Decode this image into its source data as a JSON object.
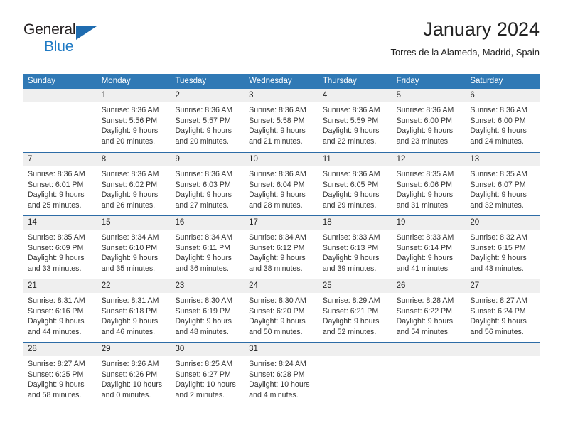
{
  "brand": {
    "name_top": "General",
    "name_bottom": "Blue",
    "triangle_color": "#1f6cb0",
    "blue_text_color": "#1f7ac4"
  },
  "header": {
    "title": "January 2024",
    "subtitle": "Torres de la Alameda, Madrid, Spain"
  },
  "theme": {
    "header_bg": "#3079b5",
    "header_text": "#ffffff",
    "daynum_bg": "#efefef",
    "row_border": "#2d6ca6",
    "body_text": "#333333"
  },
  "weekdays": [
    "Sunday",
    "Monday",
    "Tuesday",
    "Wednesday",
    "Thursday",
    "Friday",
    "Saturday"
  ],
  "weeks": [
    [
      {
        "day": "",
        "sunrise": "",
        "sunset": "",
        "daylight1": "",
        "daylight2": ""
      },
      {
        "day": "1",
        "sunrise": "Sunrise: 8:36 AM",
        "sunset": "Sunset: 5:56 PM",
        "daylight1": "Daylight: 9 hours",
        "daylight2": "and 20 minutes."
      },
      {
        "day": "2",
        "sunrise": "Sunrise: 8:36 AM",
        "sunset": "Sunset: 5:57 PM",
        "daylight1": "Daylight: 9 hours",
        "daylight2": "and 20 minutes."
      },
      {
        "day": "3",
        "sunrise": "Sunrise: 8:36 AM",
        "sunset": "Sunset: 5:58 PM",
        "daylight1": "Daylight: 9 hours",
        "daylight2": "and 21 minutes."
      },
      {
        "day": "4",
        "sunrise": "Sunrise: 8:36 AM",
        "sunset": "Sunset: 5:59 PM",
        "daylight1": "Daylight: 9 hours",
        "daylight2": "and 22 minutes."
      },
      {
        "day": "5",
        "sunrise": "Sunrise: 8:36 AM",
        "sunset": "Sunset: 6:00 PM",
        "daylight1": "Daylight: 9 hours",
        "daylight2": "and 23 minutes."
      },
      {
        "day": "6",
        "sunrise": "Sunrise: 8:36 AM",
        "sunset": "Sunset: 6:00 PM",
        "daylight1": "Daylight: 9 hours",
        "daylight2": "and 24 minutes."
      }
    ],
    [
      {
        "day": "7",
        "sunrise": "Sunrise: 8:36 AM",
        "sunset": "Sunset: 6:01 PM",
        "daylight1": "Daylight: 9 hours",
        "daylight2": "and 25 minutes."
      },
      {
        "day": "8",
        "sunrise": "Sunrise: 8:36 AM",
        "sunset": "Sunset: 6:02 PM",
        "daylight1": "Daylight: 9 hours",
        "daylight2": "and 26 minutes."
      },
      {
        "day": "9",
        "sunrise": "Sunrise: 8:36 AM",
        "sunset": "Sunset: 6:03 PM",
        "daylight1": "Daylight: 9 hours",
        "daylight2": "and 27 minutes."
      },
      {
        "day": "10",
        "sunrise": "Sunrise: 8:36 AM",
        "sunset": "Sunset: 6:04 PM",
        "daylight1": "Daylight: 9 hours",
        "daylight2": "and 28 minutes."
      },
      {
        "day": "11",
        "sunrise": "Sunrise: 8:36 AM",
        "sunset": "Sunset: 6:05 PM",
        "daylight1": "Daylight: 9 hours",
        "daylight2": "and 29 minutes."
      },
      {
        "day": "12",
        "sunrise": "Sunrise: 8:35 AM",
        "sunset": "Sunset: 6:06 PM",
        "daylight1": "Daylight: 9 hours",
        "daylight2": "and 31 minutes."
      },
      {
        "day": "13",
        "sunrise": "Sunrise: 8:35 AM",
        "sunset": "Sunset: 6:07 PM",
        "daylight1": "Daylight: 9 hours",
        "daylight2": "and 32 minutes."
      }
    ],
    [
      {
        "day": "14",
        "sunrise": "Sunrise: 8:35 AM",
        "sunset": "Sunset: 6:09 PM",
        "daylight1": "Daylight: 9 hours",
        "daylight2": "and 33 minutes."
      },
      {
        "day": "15",
        "sunrise": "Sunrise: 8:34 AM",
        "sunset": "Sunset: 6:10 PM",
        "daylight1": "Daylight: 9 hours",
        "daylight2": "and 35 minutes."
      },
      {
        "day": "16",
        "sunrise": "Sunrise: 8:34 AM",
        "sunset": "Sunset: 6:11 PM",
        "daylight1": "Daylight: 9 hours",
        "daylight2": "and 36 minutes."
      },
      {
        "day": "17",
        "sunrise": "Sunrise: 8:34 AM",
        "sunset": "Sunset: 6:12 PM",
        "daylight1": "Daylight: 9 hours",
        "daylight2": "and 38 minutes."
      },
      {
        "day": "18",
        "sunrise": "Sunrise: 8:33 AM",
        "sunset": "Sunset: 6:13 PM",
        "daylight1": "Daylight: 9 hours",
        "daylight2": "and 39 minutes."
      },
      {
        "day": "19",
        "sunrise": "Sunrise: 8:33 AM",
        "sunset": "Sunset: 6:14 PM",
        "daylight1": "Daylight: 9 hours",
        "daylight2": "and 41 minutes."
      },
      {
        "day": "20",
        "sunrise": "Sunrise: 8:32 AM",
        "sunset": "Sunset: 6:15 PM",
        "daylight1": "Daylight: 9 hours",
        "daylight2": "and 43 minutes."
      }
    ],
    [
      {
        "day": "21",
        "sunrise": "Sunrise: 8:31 AM",
        "sunset": "Sunset: 6:16 PM",
        "daylight1": "Daylight: 9 hours",
        "daylight2": "and 44 minutes."
      },
      {
        "day": "22",
        "sunrise": "Sunrise: 8:31 AM",
        "sunset": "Sunset: 6:18 PM",
        "daylight1": "Daylight: 9 hours",
        "daylight2": "and 46 minutes."
      },
      {
        "day": "23",
        "sunrise": "Sunrise: 8:30 AM",
        "sunset": "Sunset: 6:19 PM",
        "daylight1": "Daylight: 9 hours",
        "daylight2": "and 48 minutes."
      },
      {
        "day": "24",
        "sunrise": "Sunrise: 8:30 AM",
        "sunset": "Sunset: 6:20 PM",
        "daylight1": "Daylight: 9 hours",
        "daylight2": "and 50 minutes."
      },
      {
        "day": "25",
        "sunrise": "Sunrise: 8:29 AM",
        "sunset": "Sunset: 6:21 PM",
        "daylight1": "Daylight: 9 hours",
        "daylight2": "and 52 minutes."
      },
      {
        "day": "26",
        "sunrise": "Sunrise: 8:28 AM",
        "sunset": "Sunset: 6:22 PM",
        "daylight1": "Daylight: 9 hours",
        "daylight2": "and 54 minutes."
      },
      {
        "day": "27",
        "sunrise": "Sunrise: 8:27 AM",
        "sunset": "Sunset: 6:24 PM",
        "daylight1": "Daylight: 9 hours",
        "daylight2": "and 56 minutes."
      }
    ],
    [
      {
        "day": "28",
        "sunrise": "Sunrise: 8:27 AM",
        "sunset": "Sunset: 6:25 PM",
        "daylight1": "Daylight: 9 hours",
        "daylight2": "and 58 minutes."
      },
      {
        "day": "29",
        "sunrise": "Sunrise: 8:26 AM",
        "sunset": "Sunset: 6:26 PM",
        "daylight1": "Daylight: 10 hours",
        "daylight2": "and 0 minutes."
      },
      {
        "day": "30",
        "sunrise": "Sunrise: 8:25 AM",
        "sunset": "Sunset: 6:27 PM",
        "daylight1": "Daylight: 10 hours",
        "daylight2": "and 2 minutes."
      },
      {
        "day": "31",
        "sunrise": "Sunrise: 8:24 AM",
        "sunset": "Sunset: 6:28 PM",
        "daylight1": "Daylight: 10 hours",
        "daylight2": "and 4 minutes."
      },
      {
        "day": "",
        "sunrise": "",
        "sunset": "",
        "daylight1": "",
        "daylight2": ""
      },
      {
        "day": "",
        "sunrise": "",
        "sunset": "",
        "daylight1": "",
        "daylight2": ""
      },
      {
        "day": "",
        "sunrise": "",
        "sunset": "",
        "daylight1": "",
        "daylight2": ""
      }
    ]
  ]
}
